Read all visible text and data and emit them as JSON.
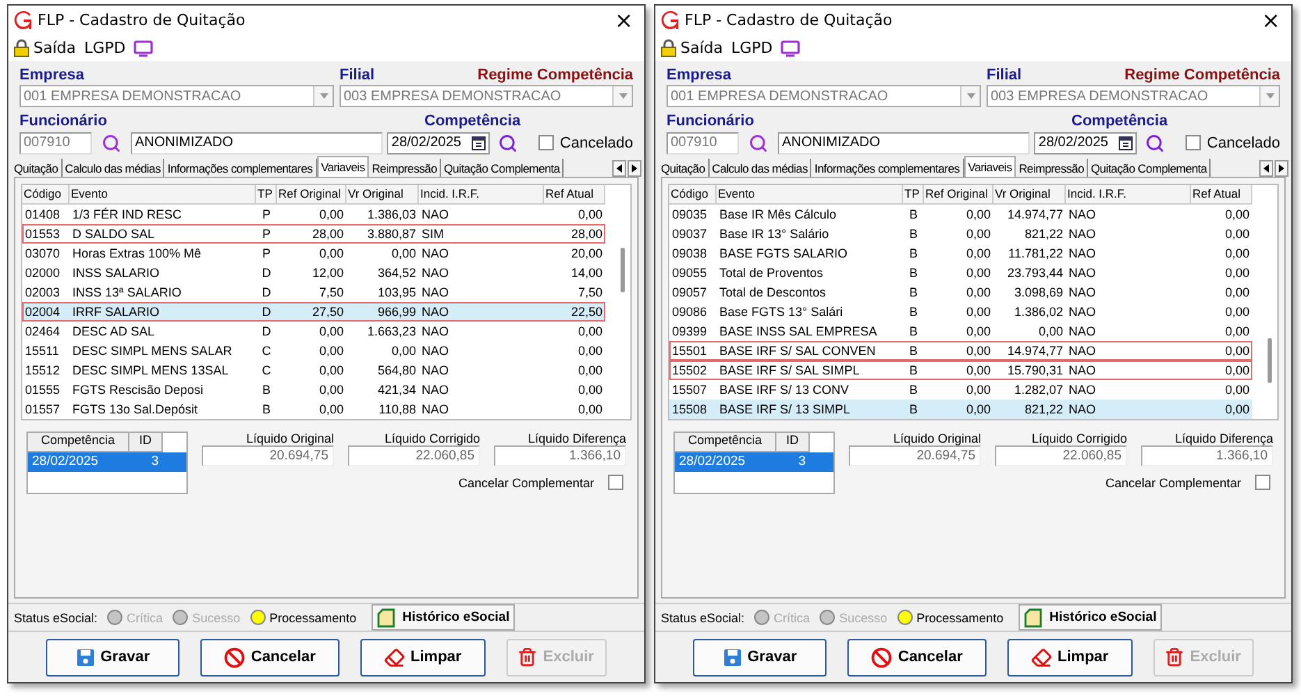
{
  "windows": [
    {
      "title": "FLP - Cadastro de Quitação",
      "close": "×",
      "toolbar": {
        "exit": "Saída",
        "lgpd": "LGPD"
      },
      "empresa": {
        "label": "Empresa",
        "value": "001 EMPRESA DEMONSTRACAO",
        "disabled": true
      },
      "filial": {
        "label": "Filial",
        "value": "003 EMPRESA DEMONSTRACAO",
        "disabled": true
      },
      "regime": "Regime Competência",
      "funcionario": {
        "label": "Funcionário",
        "code": "007910",
        "name": "ANONIMIZADO"
      },
      "competencia": {
        "label": "Competência",
        "value": "28/02/2025"
      },
      "cancelado": {
        "label": "Cancelado",
        "checked": false
      },
      "tabs": [
        {
          "label": "Quitação",
          "selected": false
        },
        {
          "label": "Calculo das médias",
          "selected": false
        },
        {
          "label": "Informações complementares",
          "selected": false
        },
        {
          "label": "Variaveis",
          "selected": true
        },
        {
          "label": "Reimpressão",
          "selected": false
        },
        {
          "label": "Quitação Complementa",
          "selected": false
        }
      ],
      "table": {
        "columns": [
          "Código",
          "Evento",
          "TP",
          "Ref Original",
          "Vr Original",
          "Incid. I.R.F.",
          "Ref Atual"
        ],
        "rows": [
          {
            "cells": [
              "01408",
              "1/3 FÉR IND RESC",
              "P",
              "0,00",
              "1.386,03",
              "NAO",
              "0,00"
            ],
            "selected": false,
            "highlighted": false
          },
          {
            "cells": [
              "01553",
              "D SALDO SAL",
              "P",
              "28,00",
              "3.880,87",
              "SIM",
              "28,00"
            ],
            "selected": false,
            "highlighted": true
          },
          {
            "cells": [
              "03070",
              "Horas Extras 100% Mê",
              "P",
              "0,00",
              "0,00",
              "NAO",
              "20,00"
            ],
            "selected": false,
            "highlighted": false
          },
          {
            "cells": [
              "02000",
              "INSS SALARIO",
              "D",
              "12,00",
              "364,52",
              "NAO",
              "14,00"
            ],
            "selected": false,
            "highlighted": false
          },
          {
            "cells": [
              "02003",
              "INSS 13ª SALARIO",
              "D",
              "7,50",
              "103,95",
              "NAO",
              "7,50"
            ],
            "selected": false,
            "highlighted": false
          },
          {
            "cells": [
              "02004",
              "IRRF SALARIO",
              "D",
              "27,50",
              "966,99",
              "NAO",
              "22,50"
            ],
            "selected": true,
            "highlighted": true
          },
          {
            "cells": [
              "02464",
              "DESC AD SAL",
              "D",
              "0,00",
              "1.663,23",
              "NAO",
              "0,00"
            ],
            "selected": false,
            "highlighted": false
          },
          {
            "cells": [
              "15511",
              "DESC SIMPL MENS SALAR",
              "C",
              "0,00",
              "0,00",
              "NAO",
              "0,00"
            ],
            "selected": false,
            "highlighted": false
          },
          {
            "cells": [
              "15512",
              "DESC SIMPL MENS 13SAL",
              "C",
              "0,00",
              "564,80",
              "NAO",
              "0,00"
            ],
            "selected": false,
            "highlighted": false
          },
          {
            "cells": [
              "01555",
              "FGTS Rescisão Deposi",
              "B",
              "0,00",
              "421,34",
              "NAO",
              "0,00"
            ],
            "selected": false,
            "highlighted": false
          },
          {
            "cells": [
              "01557",
              "FGTS 13o Sal.Depósit",
              "B",
              "0,00",
              "110,88",
              "NAO",
              "0,00"
            ],
            "selected": false,
            "highlighted": false
          }
        ]
      },
      "periods": {
        "columns": [
          "Competência",
          "ID"
        ],
        "rows": [
          {
            "cells": [
              "28/02/2025",
              "3"
            ],
            "selected": true
          }
        ]
      },
      "totals": [
        {
          "label": "Líquido Original",
          "value": "20.694,75"
        },
        {
          "label": "Líquido Corrigido",
          "value": "22.060,85"
        },
        {
          "label": "Líquido Diferença",
          "value": "1.366,10"
        }
      ],
      "cancelar_complementar": {
        "label": "Cancelar Complementar",
        "checked": false
      },
      "status": {
        "label": "Status eSocial:",
        "items": [
          {
            "label": "Crítica",
            "color": "#c4c4c4",
            "disabled": true
          },
          {
            "label": "Sucesso",
            "color": "#c4c4c4",
            "disabled": true
          },
          {
            "label": "Processamento",
            "color": "#ffff00",
            "disabled": false
          }
        ],
        "history": "Histórico eSocial"
      },
      "buttons": [
        {
          "label": "Gravar",
          "kind": "save",
          "disabled": false
        },
        {
          "label": "Cancelar",
          "kind": "cancel",
          "disabled": false
        },
        {
          "label": "Limpar",
          "kind": "clear",
          "disabled": false
        },
        {
          "label": "Excluir",
          "kind": "delete",
          "disabled": true
        }
      ]
    },
    {
      "title": "FLP - Cadastro de Quitação",
      "close": "×",
      "toolbar": {
        "exit": "Saída",
        "lgpd": "LGPD"
      },
      "empresa": {
        "label": "Empresa",
        "value": "001 EMPRESA DEMONSTRACAO",
        "disabled": true
      },
      "filial": {
        "label": "Filial",
        "value": "003 EMPRESA DEMONSTRACAO",
        "disabled": true
      },
      "regime": "Regime Competência",
      "funcionario": {
        "label": "Funcionário",
        "code": "007910",
        "name": "ANONIMIZADO"
      },
      "competencia": {
        "label": "Competência",
        "value": "28/02/2025"
      },
      "cancelado": {
        "label": "Cancelado",
        "checked": false
      },
      "tabs": [
        {
          "label": "Quitação",
          "selected": false
        },
        {
          "label": "Calculo das médias",
          "selected": false
        },
        {
          "label": "Informações complementares",
          "selected": false
        },
        {
          "label": "Variaveis",
          "selected": true
        },
        {
          "label": "Reimpressão",
          "selected": false
        },
        {
          "label": "Quitação Complementa",
          "selected": false
        }
      ],
      "table": {
        "columns": [
          "Código",
          "Evento",
          "TP",
          "Ref Original",
          "Vr Original",
          "Incid. I.R.F.",
          "Ref Atual"
        ],
        "rows": [
          {
            "cells": [
              "09035",
              "Base IR Mês Cálculo",
              "B",
              "0,00",
              "14.974,77",
              "NAO",
              "0,00"
            ],
            "selected": false,
            "highlighted": false
          },
          {
            "cells": [
              "09037",
              "Base IR 13° Salário",
              "B",
              "0,00",
              "821,22",
              "NAO",
              "0,00"
            ],
            "selected": false,
            "highlighted": false
          },
          {
            "cells": [
              "09038",
              "BASE FGTS SALARIO",
              "B",
              "0,00",
              "11.781,22",
              "NAO",
              "0,00"
            ],
            "selected": false,
            "highlighted": false
          },
          {
            "cells": [
              "09055",
              "Total de Proventos",
              "B",
              "0,00",
              "23.793,44",
              "NAO",
              "0,00"
            ],
            "selected": false,
            "highlighted": false
          },
          {
            "cells": [
              "09057",
              "Total de Descontos",
              "B",
              "0,00",
              "3.098,69",
              "NAO",
              "0,00"
            ],
            "selected": false,
            "highlighted": false
          },
          {
            "cells": [
              "09086",
              "Base FGTS 13° Salári",
              "B",
              "0,00",
              "1.386,02",
              "NAO",
              "0,00"
            ],
            "selected": false,
            "highlighted": false
          },
          {
            "cells": [
              "09399",
              "BASE INSS SAL EMPRESA",
              "B",
              "0,00",
              "0,00",
              "NAO",
              "0,00"
            ],
            "selected": false,
            "highlighted": false
          },
          {
            "cells": [
              "15501",
              "BASE IRF S/ SAL CONVEN",
              "B",
              "0,00",
              "14.974,77",
              "NAO",
              "0,00"
            ],
            "selected": false,
            "highlighted": true
          },
          {
            "cells": [
              "15502",
              "BASE IRF S/ SAL SIMPL",
              "B",
              "0,00",
              "15.790,31",
              "NAO",
              "0,00"
            ],
            "selected": false,
            "highlighted": true
          },
          {
            "cells": [
              "15507",
              "BASE IRF S/ 13 CONV",
              "B",
              "0,00",
              "1.282,07",
              "NAO",
              "0,00"
            ],
            "selected": false,
            "highlighted": false
          },
          {
            "cells": [
              "15508",
              "BASE IRF S/ 13 SIMPL",
              "B",
              "0,00",
              "821,22",
              "NAO",
              "0,00"
            ],
            "selected": true,
            "highlighted": false
          }
        ]
      },
      "periods": {
        "columns": [
          "Competência",
          "ID"
        ],
        "rows": [
          {
            "cells": [
              "28/02/2025",
              "3"
            ],
            "selected": true
          }
        ]
      },
      "totals": [
        {
          "label": "Líquido Original",
          "value": "20.694,75"
        },
        {
          "label": "Líquido Corrigido",
          "value": "22.060,85"
        },
        {
          "label": "Líquido Diferença",
          "value": "1.366,10"
        }
      ],
      "cancelar_complementar": {
        "label": "Cancelar Complementar",
        "checked": false
      },
      "status": {
        "label": "Status eSocial:",
        "items": [
          {
            "label": "Crítica",
            "color": "#c4c4c4",
            "disabled": true
          },
          {
            "label": "Sucesso",
            "color": "#c4c4c4",
            "disabled": true
          },
          {
            "label": "Processamento",
            "color": "#ffff00",
            "disabled": false
          }
        ],
        "history": "Histórico eSocial"
      },
      "buttons": [
        {
          "label": "Gravar",
          "kind": "save",
          "disabled": false
        },
        {
          "label": "Cancelar",
          "kind": "cancel",
          "disabled": false
        },
        {
          "label": "Limpar",
          "kind": "clear",
          "disabled": false
        },
        {
          "label": "Excluir",
          "kind": "delete",
          "disabled": true
        }
      ]
    }
  ]
}
